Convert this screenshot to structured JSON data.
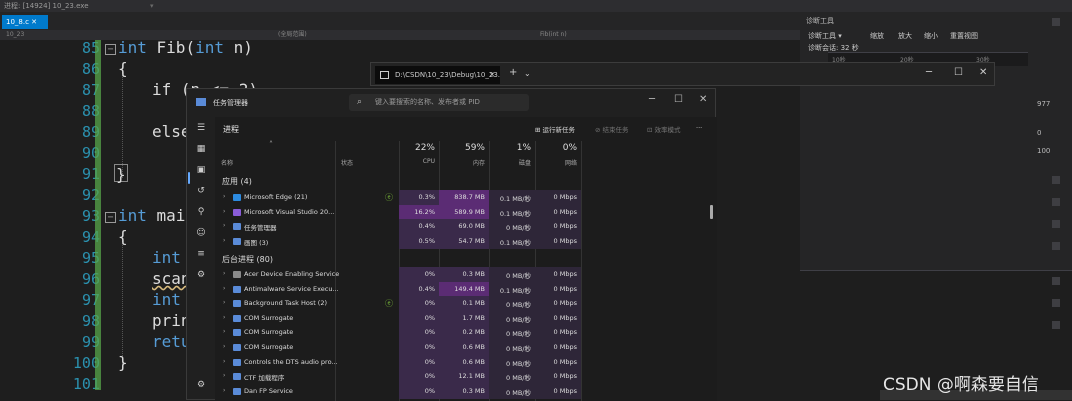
{
  "vs": {
    "top_title": "进程: [14924] 10_23.exe",
    "tab_label": "10_8.c",
    "project_label": "10_23",
    "nav_mid": "(全局范围)",
    "nav_func": "Fib(int n)",
    "code_lines": [
      85,
      86,
      87,
      88,
      89,
      90,
      91,
      92,
      93,
      94,
      95,
      96,
      97,
      98,
      99,
      100,
      101
    ]
  },
  "diag": {
    "header": "诊断工具",
    "tools": [
      "诊断工具 ▾",
      "缩放",
      "放大",
      "缩小",
      "重置视图"
    ],
    "session_label": "诊断会话: 32 秒",
    "ticks": [
      "10秒",
      "20秒",
      "30秒"
    ],
    "nums": [
      "977",
      "0",
      "100"
    ]
  },
  "terminal": {
    "tab_title": "D:\\CSDN\\10_23\\Debug\\10_23."
  },
  "tm": {
    "title": "任务管理器",
    "search_placeholder": "键入要搜索的名称、发布者或 PID",
    "page_title": "进程",
    "buttons": {
      "run": "运行新任务",
      "end": "结束任务",
      "efficiency": "效率模式",
      "more": "···"
    },
    "columns": {
      "name": "名称",
      "status": "状态",
      "cpu_pct": "22%",
      "cpu": "CPU",
      "mem_pct": "59%",
      "mem": "内存",
      "disk_pct": "1%",
      "disk": "磁盘",
      "net_pct": "0%",
      "net": "网络"
    },
    "apps_group": "应用 (4)",
    "bg_group": "后台进程 (80)",
    "apps": [
      {
        "name": "Microsoft Edge (21)",
        "cpu": "0.3%",
        "mem": "838.7 MB",
        "disk": "0.1 MB/秒",
        "net": "0 Mbps",
        "color": "#2c8be0",
        "eco": true
      },
      {
        "name": "Microsoft Visual Studio 20...",
        "cpu": "16.2%",
        "mem": "589.9 MB",
        "disk": "0.1 MB/秒",
        "net": "0 Mbps",
        "color": "#8a5cd8",
        "eco": false
      },
      {
        "name": "任务管理器",
        "cpu": "0.4%",
        "mem": "69.0 MB",
        "disk": "0 MB/秒",
        "net": "0 Mbps",
        "color": "#5a8bd8",
        "eco": false
      },
      {
        "name": "画图 (3)",
        "cpu": "0.5%",
        "mem": "54.7 MB",
        "disk": "0.1 MB/秒",
        "net": "0 Mbps",
        "color": "#5a8bd8",
        "eco": false
      }
    ],
    "bg": [
      {
        "name": "Acer Device Enabling Service",
        "cpu": "0%",
        "mem": "0.3 MB",
        "disk": "0 MB/秒",
        "net": "0 Mbps",
        "color": "#8a8a8a",
        "eco": false
      },
      {
        "name": "Antimalware Service Execu...",
        "cpu": "0.4%",
        "mem": "149.4 MB",
        "disk": "0.1 MB/秒",
        "net": "0 Mbps",
        "color": "#5a8bd8",
        "eco": false
      },
      {
        "name": "Background Task Host (2)",
        "cpu": "0%",
        "mem": "0.1 MB",
        "disk": "0 MB/秒",
        "net": "0 Mbps",
        "color": "#5a8bd8",
        "eco": true
      },
      {
        "name": "COM Surrogate",
        "cpu": "0%",
        "mem": "1.7 MB",
        "disk": "0 MB/秒",
        "net": "0 Mbps",
        "color": "#5a8bd8",
        "eco": false
      },
      {
        "name": "COM Surrogate",
        "cpu": "0%",
        "mem": "0.2 MB",
        "disk": "0 MB/秒",
        "net": "0 Mbps",
        "color": "#5a8bd8",
        "eco": false
      },
      {
        "name": "COM Surrogate",
        "cpu": "0%",
        "mem": "0.6 MB",
        "disk": "0 MB/秒",
        "net": "0 Mbps",
        "color": "#5a8bd8",
        "eco": false
      },
      {
        "name": "Controls the DTS audio pro...",
        "cpu": "0%",
        "mem": "0.6 MB",
        "disk": "0 MB/秒",
        "net": "0 Mbps",
        "color": "#5a8bd8",
        "eco": false
      },
      {
        "name": "CTF 加载程序",
        "cpu": "0%",
        "mem": "12.1 MB",
        "disk": "0 MB/秒",
        "net": "0 Mbps",
        "color": "#5a8bd8",
        "eco": false
      },
      {
        "name": "Dan FP Service",
        "cpu": "0%",
        "mem": "0.3 MB",
        "disk": "0 MB/秒",
        "net": "0 Mbps",
        "color": "#5a8bd8",
        "eco": false
      }
    ]
  },
  "watermark": "CSDN @啊森要自信"
}
